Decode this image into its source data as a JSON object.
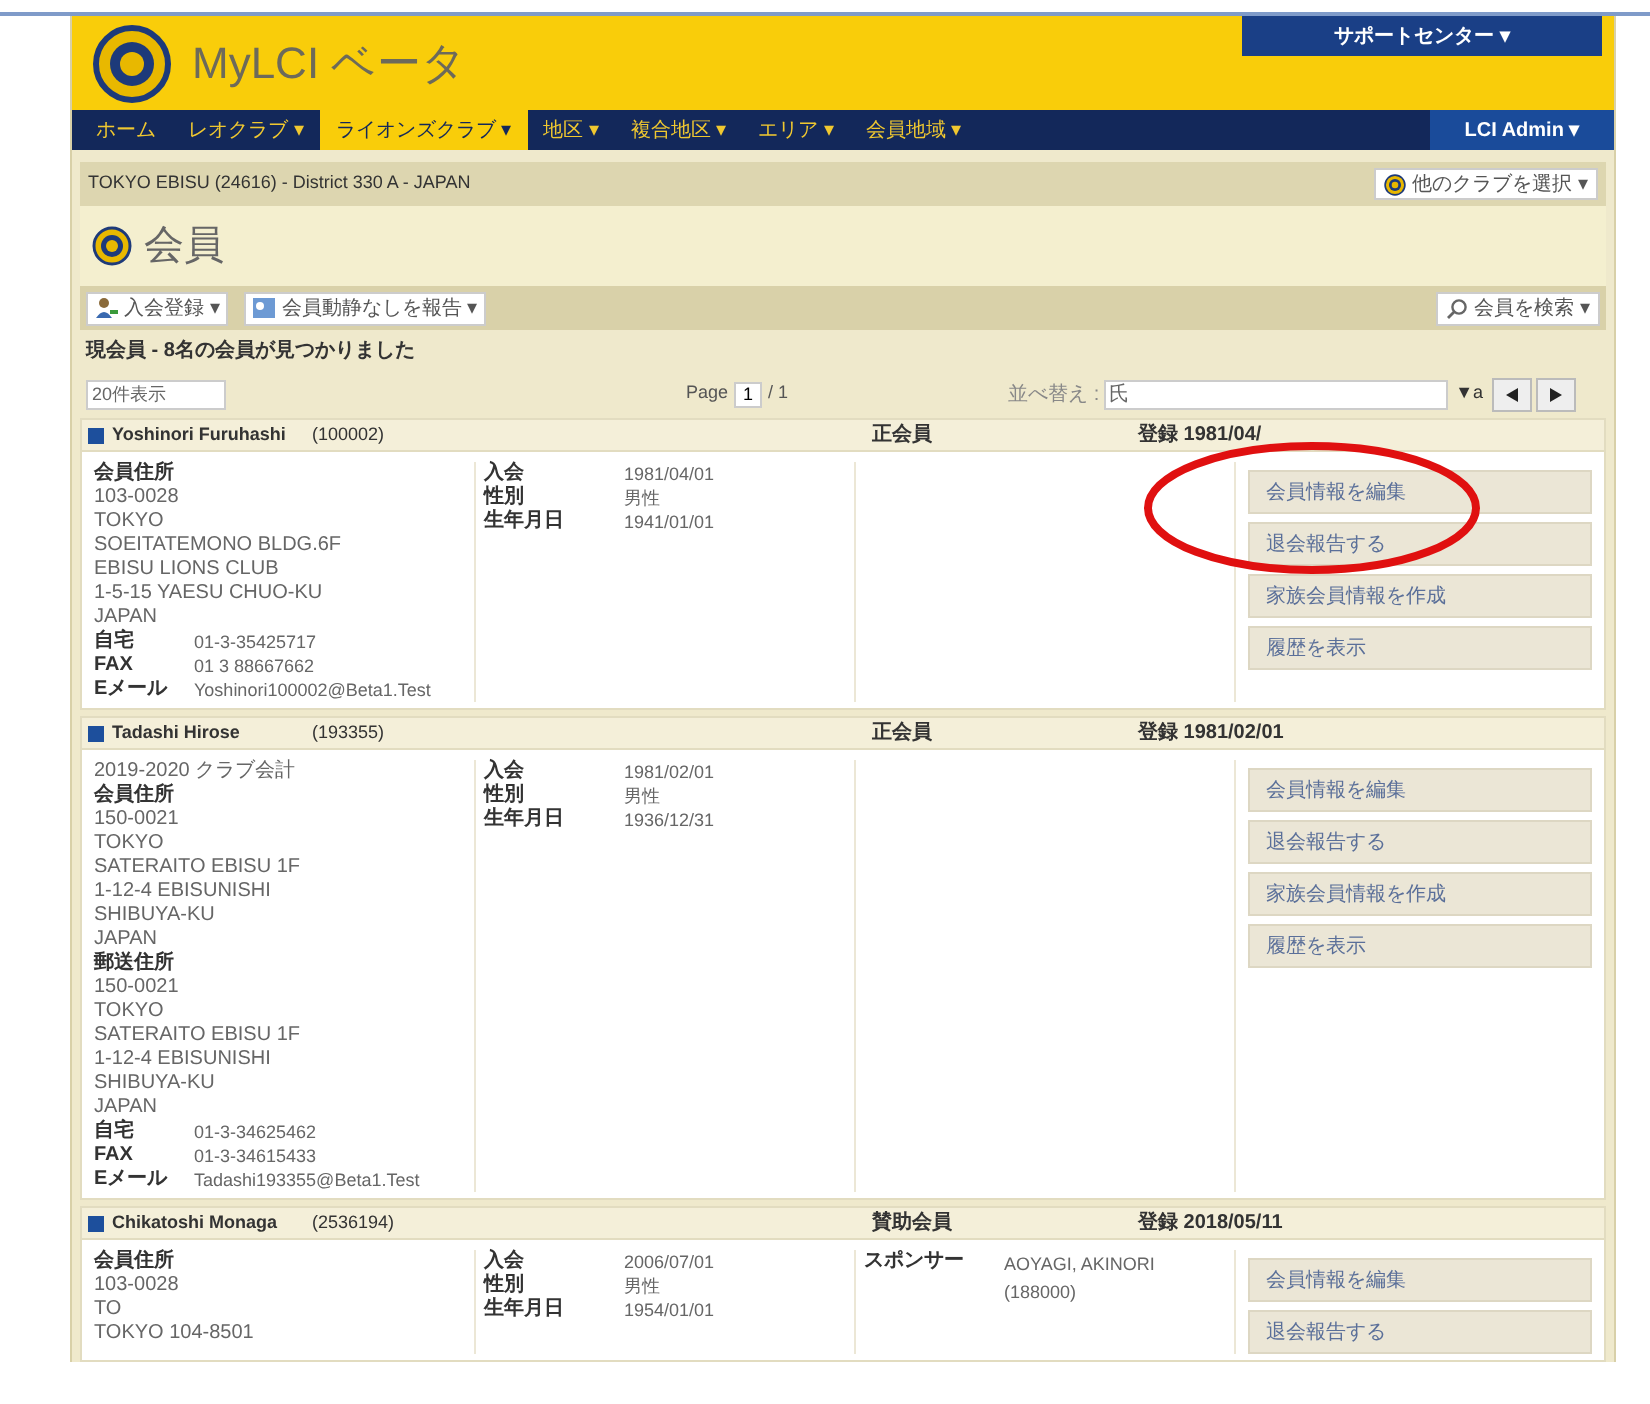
{
  "header": {
    "title": "MyLCI ベータ",
    "support_button": "サポートセンター ▾"
  },
  "nav": {
    "items": [
      {
        "label": "ホーム",
        "selected": false
      },
      {
        "label": "レオクラブ ▾",
        "selected": false
      },
      {
        "label": "ライオンズクラブ ▾",
        "selected": true
      },
      {
        "label": "地区 ▾",
        "selected": false
      },
      {
        "label": "複合地区 ▾",
        "selected": false
      },
      {
        "label": "エリア ▾",
        "selected": false
      },
      {
        "label": "会員地域 ▾",
        "selected": false
      }
    ],
    "user_menu": "LCI Admin ▾"
  },
  "club_bar": {
    "club": "TOKYO EBISU (24616) - District 330 A - JAPAN",
    "other_club_button": "他のクラブを選択 ▾"
  },
  "page_title": "会員",
  "toolbar": {
    "join_button": "入会登録 ▾",
    "report_button": "会員動静なしを報告 ▾",
    "search_button": "会員を検索 ▾"
  },
  "result_count": "現会員 - 8名の会員が見つかりました",
  "paging": {
    "page_size": "20件表示",
    "page_label": "Page",
    "page": "1",
    "page_total": "/ 1",
    "sort_label": "並べ替え :",
    "sort_value": "氏",
    "sort_order": "▼a"
  },
  "members": [
    {
      "name": "Yoshinori Furuhashi",
      "id": "(100002)",
      "type": "正会員",
      "registered": "登録 1981/04/",
      "address": [
        {
          "kind": "heading",
          "text": "会員住所"
        },
        {
          "kind": "text",
          "text": "103-0028"
        },
        {
          "kind": "text",
          "text": "TOKYO"
        },
        {
          "kind": "text",
          "text": "SOEITATEMONO BLDG.6F"
        },
        {
          "kind": "text",
          "text": "EBISU LIONS CLUB"
        },
        {
          "kind": "text",
          "text": "1-5-15 YAESU CHUO-KU"
        },
        {
          "kind": "text",
          "text": "JAPAN"
        },
        {
          "kind": "contact",
          "label": "自宅",
          "value": "01-3-35425717"
        },
        {
          "kind": "contact",
          "label": "FAX",
          "value": "01 3 88667662"
        },
        {
          "kind": "contact",
          "label": "Eメール",
          "value": "Yoshinori100002@Beta1.Test"
        }
      ],
      "info": [
        {
          "label": "入会",
          "value": "1981/04/01"
        },
        {
          "label": "性別",
          "value": "男性"
        },
        {
          "label": "生年月日",
          "value": "1941/01/01"
        }
      ],
      "actions": [
        "会員情報を編集",
        "退会報告する",
        "家族会員情報を作成",
        "履歴を表示"
      ],
      "annotated": true
    },
    {
      "name": "Tadashi Hirose",
      "id": "(193355)",
      "type": "正会員",
      "registered": "登録 1981/02/01",
      "address": [
        {
          "kind": "text",
          "text": "2019-2020 クラブ会計"
        },
        {
          "kind": "heading",
          "text": "会員住所"
        },
        {
          "kind": "text",
          "text": "150-0021"
        },
        {
          "kind": "text",
          "text": "TOKYO"
        },
        {
          "kind": "text",
          "text": "SATERAITO EBISU 1F"
        },
        {
          "kind": "text",
          "text": "1-12-4 EBISUNISHI"
        },
        {
          "kind": "text",
          "text": "SHIBUYA-KU"
        },
        {
          "kind": "text",
          "text": "JAPAN"
        },
        {
          "kind": "heading",
          "text": "郵送住所"
        },
        {
          "kind": "text",
          "text": "150-0021"
        },
        {
          "kind": "text",
          "text": "TOKYO"
        },
        {
          "kind": "text",
          "text": "SATERAITO EBISU 1F"
        },
        {
          "kind": "text",
          "text": "1-12-4 EBISUNISHI"
        },
        {
          "kind": "text",
          "text": "SHIBUYA-KU"
        },
        {
          "kind": "text",
          "text": "JAPAN"
        },
        {
          "kind": "contact",
          "label": "自宅",
          "value": "01-3-34625462"
        },
        {
          "kind": "contact",
          "label": "FAX",
          "value": "01-3-34615433"
        },
        {
          "kind": "contact",
          "label": "Eメール",
          "value": "Tadashi193355@Beta1.Test"
        }
      ],
      "info": [
        {
          "label": "入会",
          "value": "1981/02/01"
        },
        {
          "label": "性別",
          "value": "男性"
        },
        {
          "label": "生年月日",
          "value": "1936/12/31"
        }
      ],
      "actions": [
        "会員情報を編集",
        "退会報告する",
        "家族会員情報を作成",
        "履歴を表示"
      ]
    },
    {
      "name": "Chikatoshi Monaga",
      "id": "(2536194)",
      "type": "賛助会員",
      "registered": "登録 2018/05/11",
      "address": [
        {
          "kind": "heading",
          "text": "会員住所"
        },
        {
          "kind": "text",
          "text": "103-0028"
        },
        {
          "kind": "text",
          "text": "TO"
        },
        {
          "kind": "text",
          "text": "TOKYO 104-8501"
        }
      ],
      "info": [
        {
          "label": "入会",
          "value": "2006/07/01"
        },
        {
          "label": "性別",
          "value": "男性"
        },
        {
          "label": "生年月日",
          "value": "1954/01/01"
        }
      ],
      "sponsor": {
        "label": "スポンサー",
        "lines": [
          "AOYAGI, AKINORI",
          "(188000)"
        ]
      },
      "actions": [
        "会員情報を編集",
        "退会報告する"
      ]
    }
  ]
}
